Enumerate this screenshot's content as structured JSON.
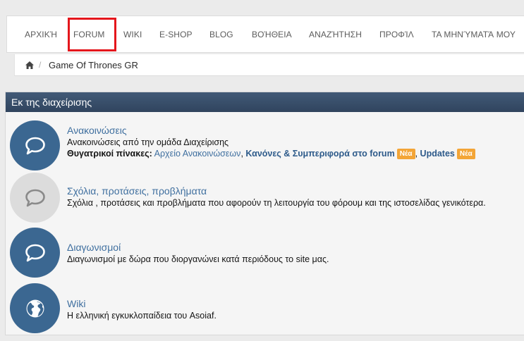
{
  "nav": {
    "items": [
      "ΑΡΧΙΚΉ",
      "FORUM",
      "WIKI",
      "E-SHOP",
      "BLOG",
      "ΒΟΉΘΕΙΑ",
      "ΑΝΑΖΉΤΗΣΗ",
      "ΠΡΟΦΊΛ",
      "ΤΑ ΜΗΝΎΜΑΤΆ ΜΟΥ"
    ],
    "selected": "FORUM"
  },
  "breadcrumb": {
    "home_icon": "home-icon",
    "separator": "/",
    "items": [
      "Game Of Thrones GR"
    ]
  },
  "category": {
    "title": "Εκ της διαχείρισης",
    "header_color": "#3a506c",
    "nodes": [
      {
        "title": "Ανακοινώσεις",
        "description": "Ανακοινώσεις από την ομάδα Διαχείρισης",
        "icon": "speech-bubble-icon",
        "unread": true,
        "subforums_label": "Θυγατρικοί πίνακες:",
        "subforums": [
          {
            "label": "Αρχείο Ανακοινώσεων",
            "bold": false,
            "badge": ""
          },
          {
            "label": "Κανόνες & Συμπεριφορά στο forum",
            "bold": true,
            "badge": "Νέα"
          },
          {
            "label": "Updates",
            "bold": true,
            "badge": "Νέα"
          }
        ]
      },
      {
        "title": "Σχόλια, προτάσεις, προβλήματα",
        "description": "Σχόλια , προτάσεις και προβλήματα που αφορούν τη λειτουργία του φόρουμ και της ιστοσελίδας γενικότερα.",
        "icon": "speech-bubble-icon",
        "unread": false
      },
      {
        "title": "Διαγωνισμοί",
        "description": "Διαγωνισμοί με δώρα που διοργανώνει κατά περιόδους το site μας.",
        "icon": "speech-bubble-icon",
        "unread": true
      },
      {
        "title": "Wiki",
        "description": "Η ελληνική εγκυκλοπαίδεια του Asoiaf.",
        "icon": "globe-icon",
        "unread": true
      }
    ]
  },
  "colors": {
    "link": "#3f6f9f",
    "unread_icon_bg": "#3b6791",
    "read_icon_bg": "#dcdcdc",
    "badge": "#f3a537",
    "highlight_box": "#e4161c"
  }
}
